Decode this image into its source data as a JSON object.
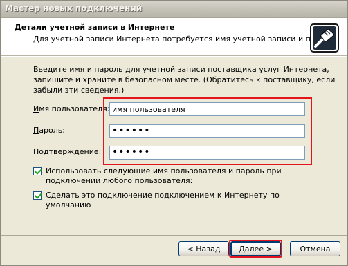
{
  "window": {
    "title": "Мастер новых подключений"
  },
  "header": {
    "title": "Детали учетной записи в Интернете",
    "subtitle": "Для учетной записи Интернета потребуется имя учетной записи и пароль.",
    "icon": "network-cable-icon"
  },
  "description": "Введите имя и пароль для учетной записи поставщика услуг Интернета, запишите и храните в безопасном месте. (Обратитесь к поставщику, если забыли эти сведения.)",
  "form": {
    "username": {
      "label_pre": "",
      "label_hot": "И",
      "label_post": "мя пользователя:",
      "value": "имя пользователя"
    },
    "password": {
      "label_pre": "",
      "label_hot": "П",
      "label_post": "ароль:",
      "value": "••••••"
    },
    "confirm": {
      "label_pre": "Под",
      "label_hot": "т",
      "label_post": "верждение:",
      "value": "••••••"
    }
  },
  "options": [
    {
      "label": "Использовать следующие имя пользователя и пароль при подключении любого пользователя:",
      "checked": true
    },
    {
      "label": "Сделать это подключение подключением к Интернету по умолчанию",
      "checked": true
    }
  ],
  "buttons": {
    "back": "< Назад",
    "next": "Далее >",
    "cancel": "Отмена"
  },
  "colors": {
    "highlight": "#e4141d",
    "header_bg": "#ffffff",
    "dialog_bg": "#ece9d8"
  }
}
